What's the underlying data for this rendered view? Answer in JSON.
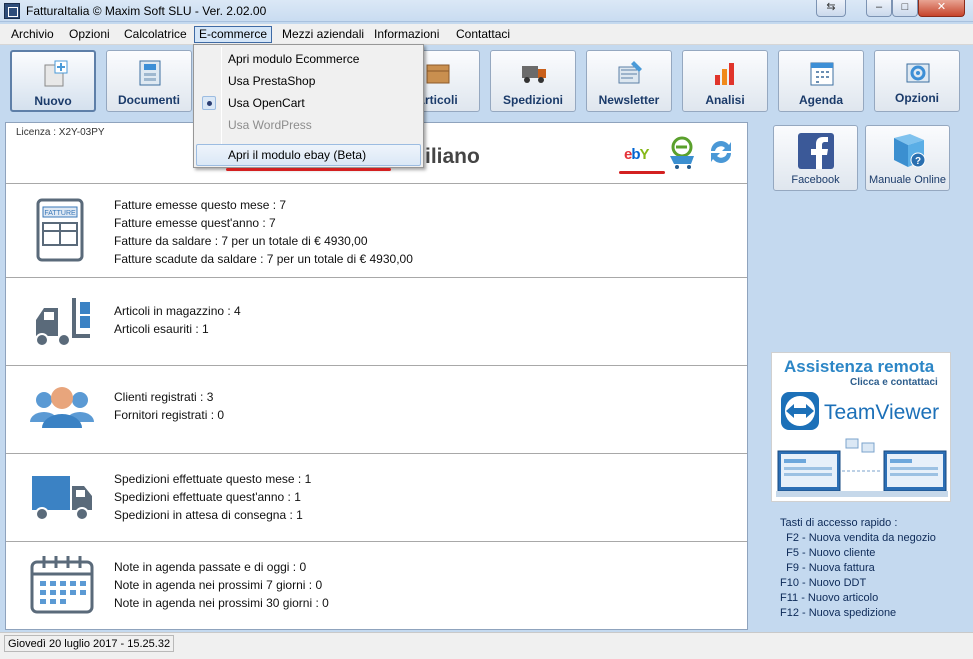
{
  "window": {
    "title": "FatturaItalia © Maxim Soft SLU - Ver. 2.02.00"
  },
  "menubar": {
    "items": [
      "Archivio",
      "Opzioni",
      "Calcolatrice",
      "E-commerce",
      "Mezzi aziendali",
      "Informazioni",
      "Contattaci"
    ]
  },
  "toolbar": {
    "buttons": [
      "Nuovo",
      "Documenti",
      "Articoli",
      "Spedizioni",
      "Newsletter",
      "Analisi",
      "Agenda",
      "Opzioni"
    ]
  },
  "ecommerce_menu": {
    "items": [
      {
        "label": "Apri modulo Ecommerce",
        "enabled": true
      },
      {
        "label": "Usa PrestaShop",
        "enabled": true
      },
      {
        "label": "Usa OpenCart",
        "enabled": true,
        "checked": true
      },
      {
        "label": "Usa WordPress",
        "enabled": false
      },
      {
        "label": "Apri il modulo ebay  (Beta)",
        "enabled": true,
        "highlighted": true
      }
    ]
  },
  "header": {
    "license": "Licenza : X2Y-03PY",
    "company_fragment": "iliano",
    "ebay_logo": "ebY"
  },
  "stats": {
    "invoices": [
      "Fatture emesse questo mese : 7",
      "Fatture emesse quest'anno : 7",
      "Fatture da saldare : 7 per un totale di € 4930,00",
      "Fatture scadute da saldare : 7 per un totale di € 4930,00"
    ],
    "invoice_icon_label": "FATTURE",
    "warehouse": [
      "Articoli in magazzino : 4",
      "Articoli esauriti : 1"
    ],
    "contacts": [
      "Clienti registrati : 3",
      "Fornitori registrati : 0"
    ],
    "shipments": [
      "Spedizioni effettuate questo mese : 1",
      "Spedizioni effettuate quest'anno : 1",
      "Spedizioni in attesa di consegna : 1"
    ],
    "agenda": [
      "Note in agenda passate e di oggi : 0",
      "Note in agenda nei prossimi 7 giorni : 0",
      "Note in agenda nei prossimi 30 giorni : 0"
    ]
  },
  "side": {
    "facebook": "Facebook",
    "manual": "Manuale Online",
    "remote_title": "Assistenza remota",
    "remote_sub": "Clicca e contattaci",
    "teamviewer": "TeamViewer",
    "shortcuts_title": "Tasti di accesso rapido :",
    "shortcuts": [
      "  F2 - Nuova vendita da negozio",
      "  F5 - Nuovo cliente",
      "  F9 - Nuova fattura",
      "F10 - Nuovo DDT",
      "F11 - Nuovo articolo",
      "F12 - Nuova spedizione"
    ]
  },
  "statusbar": {
    "text": "Giovedì 20 luglio 2017  -  15.25.32"
  },
  "colors": {
    "background": "#c4d9ef",
    "accent": "#1b3b6a",
    "annotation": "#d32020"
  }
}
